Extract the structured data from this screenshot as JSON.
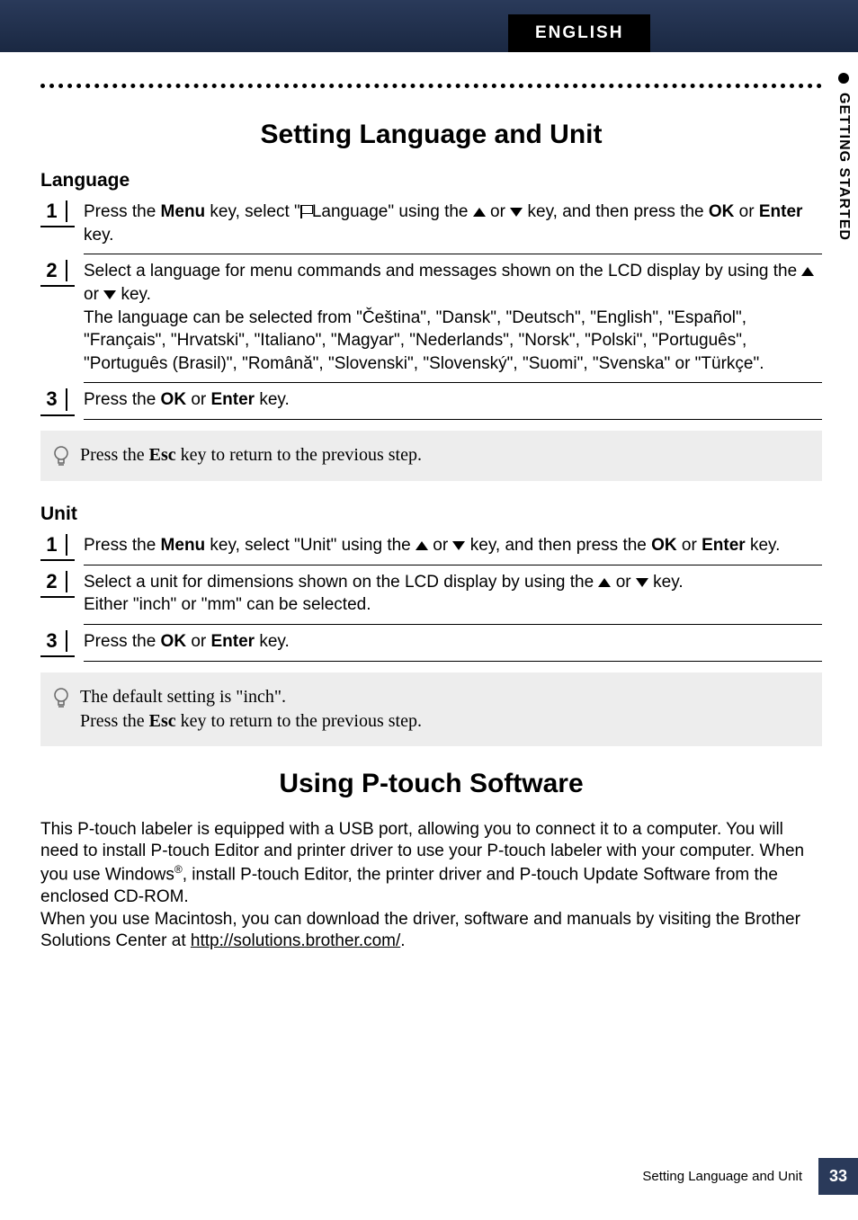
{
  "header": {
    "tab": "ENGLISH"
  },
  "side_tab": {
    "text": "GETTING STARTED"
  },
  "section1": {
    "title": "Setting Language and Unit",
    "language": {
      "heading": "Language",
      "steps": {
        "s1": {
          "num": "1",
          "t1": "Press the ",
          "menu": "Menu",
          "t2": " key, select \"",
          "t3": "Language\" using the ",
          "t4": " or ",
          "t5": " key, and then press the ",
          "ok": "OK",
          "t6": " or ",
          "enter": "Enter",
          "t7": " key."
        },
        "s2": {
          "num": "2",
          "line1a": "Select a language for menu commands and messages shown on the LCD display by using the ",
          "line1b": " or ",
          "line1c": " key.",
          "line2": "The language can be selected from \"Čeština\", \"Dansk\", \"Deutsch\", \"English\", \"Español\", \"Français\", \"Hrvatski\", \"Italiano\", \"Magyar\", \"Nederlands\", \"Norsk\", \"Polski\", \"Português\", \"Português (Brasil)\", \"Română\", \"Slovenski\", \"Slovenský\", \"Suomi\", \"Svenska\" or \"Türkçe\"."
        },
        "s3": {
          "num": "3",
          "t1": "Press the ",
          "ok": "OK",
          "t2": " or ",
          "enter": "Enter",
          "t3": " key."
        }
      },
      "tip": {
        "t1": "Press the ",
        "esc": "Esc",
        "t2": " key to return to the previous step."
      }
    },
    "unit": {
      "heading": "Unit",
      "steps": {
        "s1": {
          "num": "1",
          "t1": "Press the ",
          "menu": "Menu",
          "t2": " key, select \"Unit\" using the ",
          "t3": " or ",
          "t4": "  key, and then press the ",
          "ok": "OK",
          "t5": " or ",
          "enter": "Enter",
          "t6": " key."
        },
        "s2": {
          "num": "2",
          "t1": "Select a unit for dimensions shown on the LCD display by using the ",
          "t2": " or ",
          "t3": " key.",
          "line2": "Either \"inch\" or \"mm\" can be selected."
        },
        "s3": {
          "num": "3",
          "t1": "Press the ",
          "ok": "OK",
          "t2": " or ",
          "enter": "Enter",
          "t3": " key."
        }
      },
      "tip": {
        "line1": "The default setting is \"inch\".",
        "t1": "Press the ",
        "esc": "Esc",
        "t2": " key to return to the previous step."
      }
    }
  },
  "section2": {
    "title": "Using P-touch Software",
    "intro": {
      "t1": "This P-touch labeler is equipped with a USB port, allowing you to connect it to a computer. You will need to install P-touch Editor and printer driver to use your P-touch labeler with your computer. When you use Windows",
      "reg": "®",
      "t2": ", install P-touch Editor, the printer driver and P-touch Update Software from the enclosed CD-ROM.",
      "t3": "When you use Macintosh, you can download the driver, software and manuals by visiting the Brother Solutions Center at ",
      "url": "http://solutions.brother.com/",
      "t4": "."
    }
  },
  "footer": {
    "text": "Setting Language and Unit",
    "page": "33"
  }
}
